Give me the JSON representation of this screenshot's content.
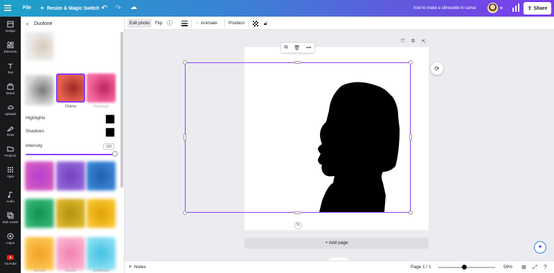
{
  "topbar": {
    "file_label": "File",
    "resize_label": "Resize & Magic Switch",
    "doc_title": "how to make a silhouette in canva",
    "share_label": "Share"
  },
  "rail": [
    {
      "label": "Design",
      "icon": "design-icon"
    },
    {
      "label": "Elements",
      "icon": "elements-icon"
    },
    {
      "label": "Text",
      "icon": "text-icon"
    },
    {
      "label": "Brand",
      "icon": "brand-icon"
    },
    {
      "label": "Uploads",
      "icon": "uploads-icon"
    },
    {
      "label": "Draw",
      "icon": "draw-icon"
    },
    {
      "label": "Projects",
      "icon": "projects-icon"
    },
    {
      "label": "Apps",
      "icon": "apps-icon"
    },
    {
      "label": "Audio",
      "icon": "audio-icon"
    },
    {
      "label": "Bulk create",
      "icon": "bulk-create-icon"
    },
    {
      "label": "Logos",
      "icon": "logos-icon"
    },
    {
      "label": "YouTube",
      "icon": "youtube-icon"
    }
  ],
  "panel": {
    "title": "Duotone",
    "selected_preset": "Cherry",
    "next_preset_label": "Flamingo",
    "highlights_label": "Highlights",
    "shadows_label": "Shadows",
    "intensity_label": "Intensity",
    "intensity_value": "100",
    "bottom_labels": [
      "Sunset",
      "Ocean",
      "Sunflower"
    ]
  },
  "context_bar": {
    "edit_photo": "Edit photo",
    "flip": "Flip",
    "animate": "Animate",
    "position": "Position"
  },
  "canvas": {
    "add_page": "+ Add page"
  },
  "footer": {
    "notes": "Notes",
    "page_count": "Page 1 / 1",
    "zoom": "59%",
    "zoom_level": 0.45
  },
  "colors": {
    "accent": "#8b3dff",
    "rail_bg": "#18191b",
    "highlight_swatch": "#000000",
    "shadow_swatch": "#000000"
  }
}
